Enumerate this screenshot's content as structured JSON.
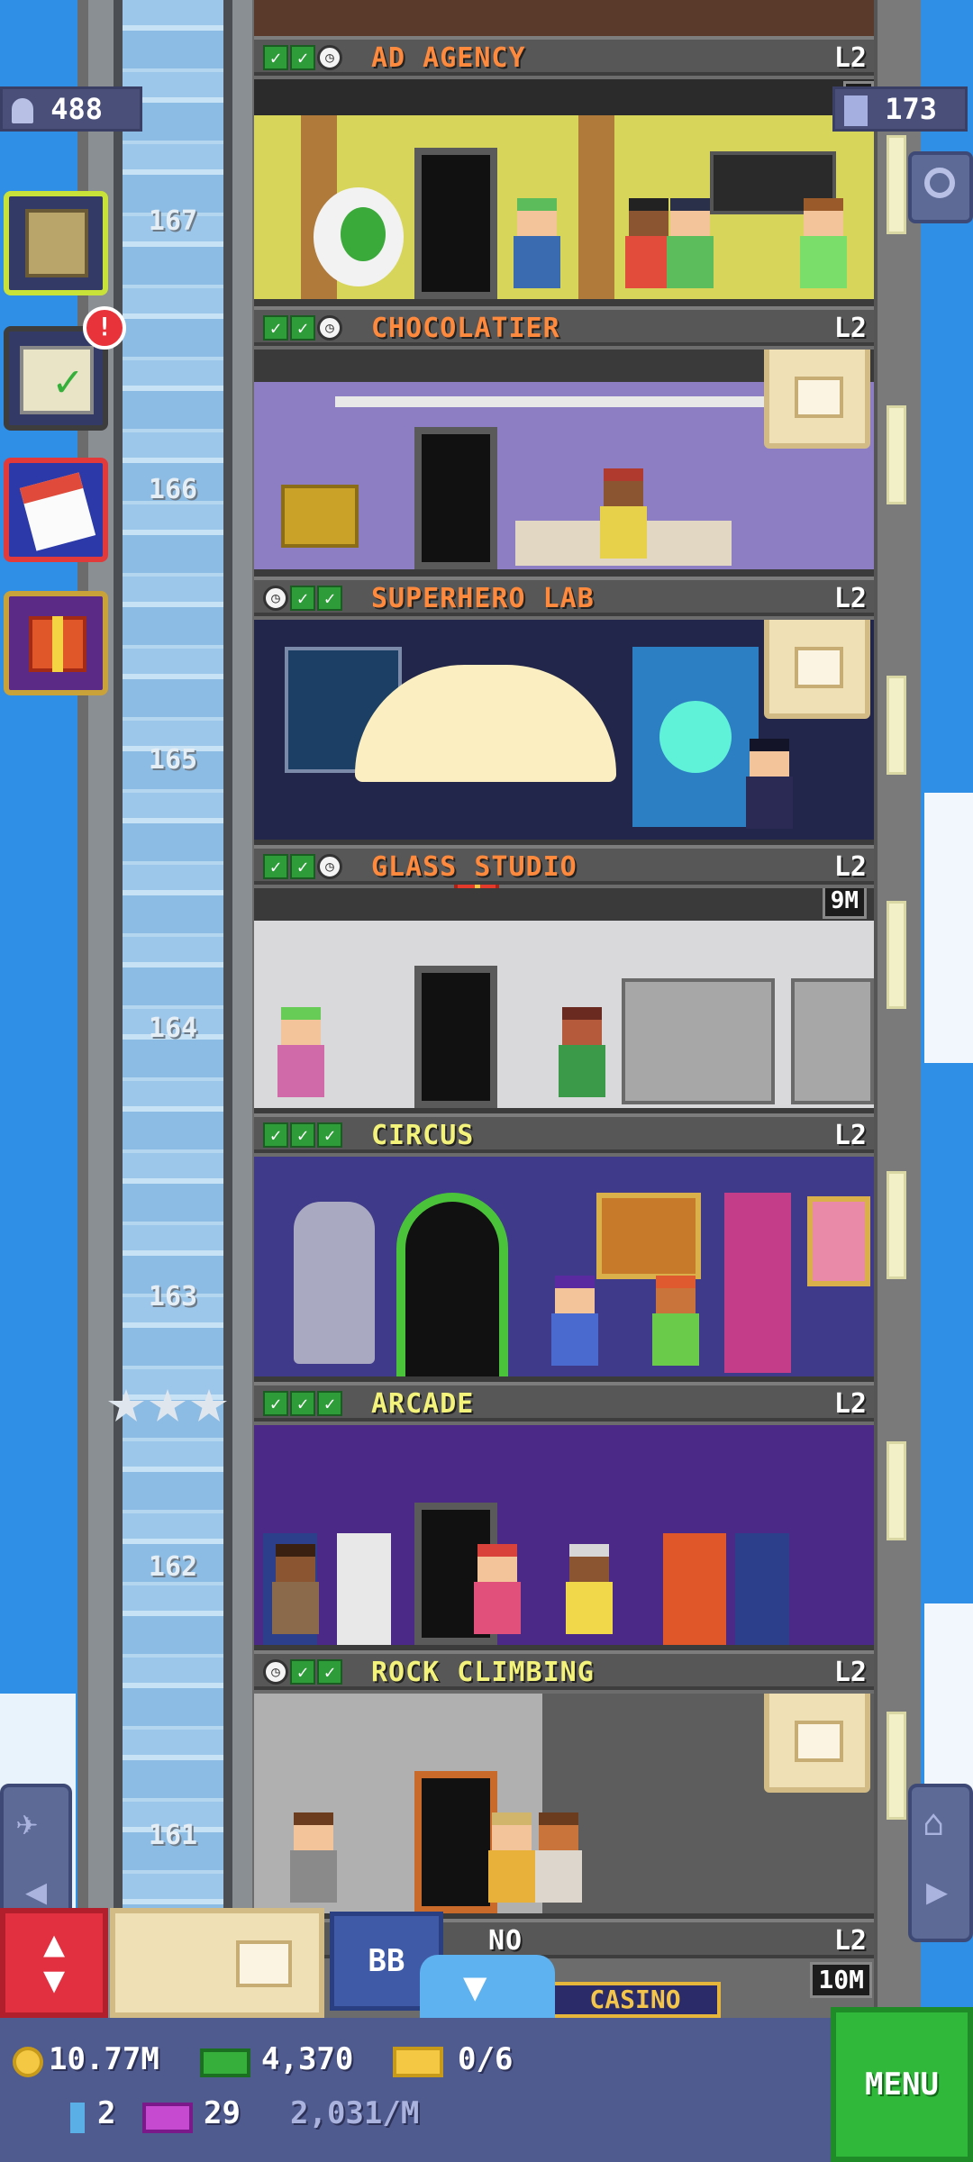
{
  "top_counters": {
    "population": "488",
    "floors": "173"
  },
  "floors": [
    {
      "name": "AD AGENCY",
      "level": "L2",
      "name_color": "#ff8a3d",
      "badge": "6"
    },
    {
      "number": "167",
      "name": "CHOCOLATIER",
      "level": "L2",
      "name_color": "#ff8a3d",
      "badge": ""
    },
    {
      "number": "166",
      "name": "SUPERHERO LAB",
      "level": "L2",
      "name_color": "#ff8a3d",
      "badge": ""
    },
    {
      "number": "165",
      "name": "GLASS STUDIO",
      "level": "L2",
      "name_color": "#ff8a3d",
      "badge": "9M"
    },
    {
      "number": "164",
      "name": "CIRCUS",
      "level": "L2",
      "name_color": "#f3f27a",
      "badge": ""
    },
    {
      "number": "163",
      "name": "ARCADE",
      "level": "L2",
      "name_color": "#f3f27a",
      "badge": ""
    },
    {
      "number": "162",
      "name": "ROCK CLIMBING",
      "level": "L2",
      "name_color": "#f3f27a",
      "badge": ""
    },
    {
      "number": "161",
      "name": "NO",
      "level": "L2",
      "name_color": "#ffffff",
      "badge": "10M"
    }
  ],
  "casino_sign": "CASINO",
  "bb_button": "BB",
  "bottom": {
    "coins": "10.77M",
    "bux": "4,370",
    "tickets": "0/6",
    "keys": "2",
    "vip": "29",
    "income": "2,031/M",
    "menu": "MENU"
  },
  "alert_badge": "!",
  "colors": {
    "sky": "#2f8ee6",
    "menu_green": "#2fb83a",
    "bottom_bar": "#4f5a8e",
    "elevator_red": "#e33040"
  },
  "icons": [
    "person-icon",
    "building-icon",
    "search-icon",
    "checklist-icon",
    "calendar-icon",
    "gift-icon",
    "plane-icon",
    "home-icon",
    "coin-icon",
    "bux-icon",
    "ticket-icon",
    "key-icon",
    "vip-icon",
    "up-down-arrows-icon",
    "down-arrow-icon",
    "stock-box-icon"
  ]
}
